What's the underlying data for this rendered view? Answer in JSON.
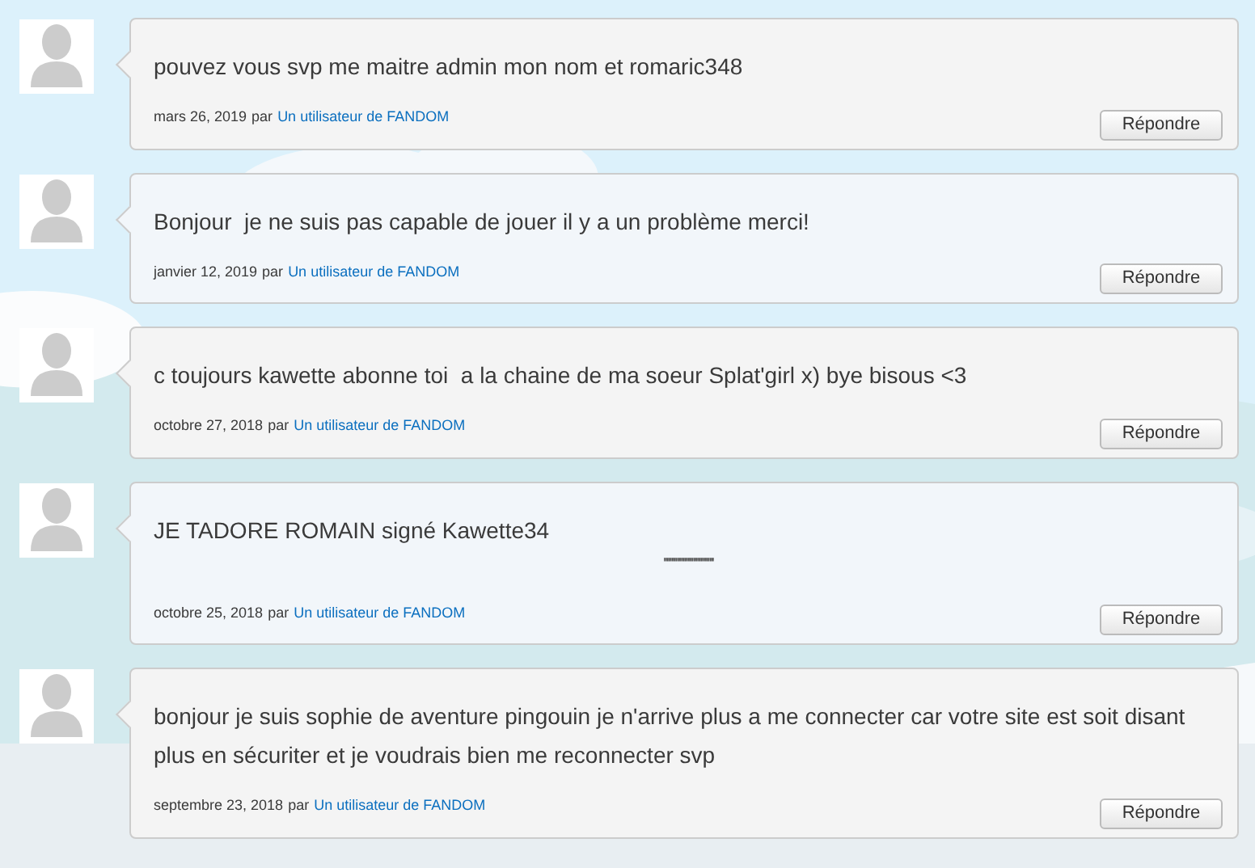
{
  "comments": [
    {
      "paragraphs": [
        {
          "kind": "text",
          "text": "pouvez vous svp me maitre admin mon nom et romaric348"
        }
      ],
      "date": "mars 26, 2019",
      "by": "par",
      "author": "Un utilisateur de FANDOM",
      "reply": "Répondre"
    },
    {
      "paragraphs": [
        {
          "kind": "text",
          "text": "Bonjour  je ne suis pas capable de jouer il y a un problème merci!"
        }
      ],
      "date": "janvier 12, 2019",
      "by": "par",
      "author": "Un utilisateur de FANDOM",
      "reply": "Répondre"
    },
    {
      "paragraphs": [
        {
          "kind": "text",
          "text": "c toujours kawette abonne toi  a la chaine de ma soeur Splat'girl x) bye bisous <3"
        }
      ],
      "date": "octobre 27, 2018",
      "by": "par",
      "author": "Un utilisateur de FANDOM",
      "reply": "Répondre"
    },
    {
      "paragraphs": [
        {
          "kind": "text",
          "text": "JE TADORE ROMAIN signé Kawette34"
        },
        {
          "kind": "centered",
          "text": "''''''''''''''''''''''''''''''''''"
        }
      ],
      "date": "octobre 25, 2018",
      "by": "par",
      "author": "Un utilisateur de FANDOM",
      "reply": "Répondre"
    },
    {
      "paragraphs": [
        {
          "kind": "text",
          "text": "bonjour je suis sophie de aventure pingouin je n'arrive plus a me connecter car votre site est soit disant plus en sécuriter et je voudrais bien me reconnecter svp"
        }
      ],
      "date": "septembre 23, 2018",
      "by": "par",
      "author": "Un utilisateur de FANDOM",
      "reply": "Répondre"
    }
  ]
}
